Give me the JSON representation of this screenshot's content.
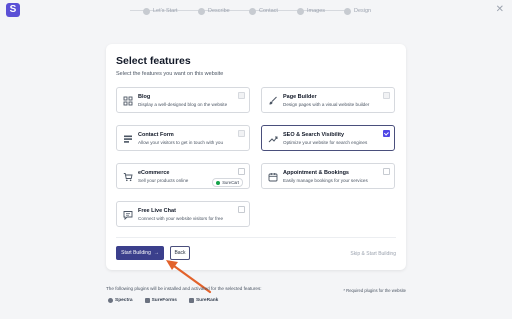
{
  "app": {
    "logo_letter": "S",
    "close_icon": "close-icon"
  },
  "steps": [
    {
      "label": "Let's Start"
    },
    {
      "label": "Describe"
    },
    {
      "label": "Contact"
    },
    {
      "label": "Images"
    },
    {
      "label": "Design"
    }
  ],
  "main": {
    "title": "Select features",
    "subtitle": "Select the features you want on this website",
    "features": [
      {
        "name": "Blog",
        "desc": "Display a well-designed blog on the website",
        "icon": "blog-grid-icon",
        "checked": false,
        "locked": true
      },
      {
        "name": "Page Builder",
        "desc": "Design pages with a visual website builder",
        "icon": "brush-icon",
        "checked": false,
        "locked": true
      },
      {
        "name": "Contact Form",
        "desc": "Allow your visitors to get in touch with you",
        "icon": "form-icon",
        "checked": false,
        "locked": true
      },
      {
        "name": "SEO & Search Visibility",
        "desc": "Optimize your website for search engines",
        "icon": "trend-icon",
        "checked": true,
        "locked": false
      },
      {
        "name": "eCommerce",
        "desc": "Sell your products online",
        "icon": "cart-icon",
        "checked": false,
        "locked": false,
        "badge": "SureCart"
      },
      {
        "name": "Appointment & Bookings",
        "desc": "Easily manage bookings for your services",
        "icon": "calendar-icon",
        "checked": false,
        "locked": false
      },
      {
        "name": "Free Live Chat",
        "desc": "Connect with your website visitors for free",
        "icon": "chat-icon",
        "checked": false,
        "locked": false
      }
    ],
    "start_button": "Start Building",
    "back_button": "Back",
    "skip_link": "Skip & Start Building"
  },
  "footer": {
    "note": "The following plugins will be installed and activated for the selected features:",
    "required": "* Required plugins for the website",
    "plugins": [
      "Spectra",
      "SureForms",
      "SureRank"
    ]
  },
  "colors": {
    "accent": "#4f46e5",
    "primary_button": "#3b3f8c",
    "annotation_arrow": "#e2622b"
  }
}
